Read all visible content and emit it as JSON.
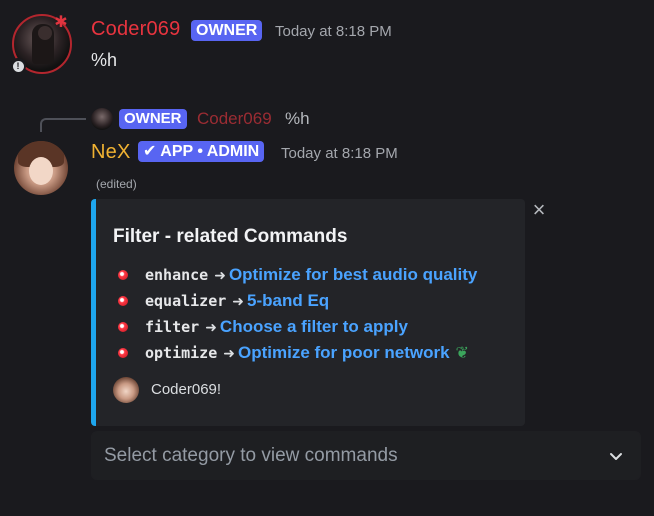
{
  "message1": {
    "username": "Coder069",
    "badge": "OWNER",
    "timestamp": "Today at 8:18 PM",
    "content": "%h",
    "name_color": "#e8343f"
  },
  "reply": {
    "badge": "OWNER",
    "username": "Coder069",
    "content": "%h"
  },
  "message2": {
    "username": "NeX",
    "badge": "✔ APP • ADMIN",
    "timestamp": "Today at 8:18 PM",
    "edited": "(edited)",
    "name_color": "#f0b232"
  },
  "embed": {
    "accent_color": "#1ea6ee",
    "close_icon": "×",
    "title": "Filter - related Commands",
    "commands": [
      {
        "name": "enhance",
        "arrow": "➜",
        "description": "Optimize for best audio quality"
      },
      {
        "name": "equalizer",
        "arrow": "➜",
        "description": "5-band Eq"
      },
      {
        "name": "filter",
        "arrow": "➜",
        "description": "Choose a filter to apply"
      },
      {
        "name": "optimize",
        "arrow": "➜",
        "description": "Optimize for poor network"
      }
    ],
    "footer": "Coder069!"
  },
  "select_menu": {
    "placeholder": "Select category to view commands"
  }
}
